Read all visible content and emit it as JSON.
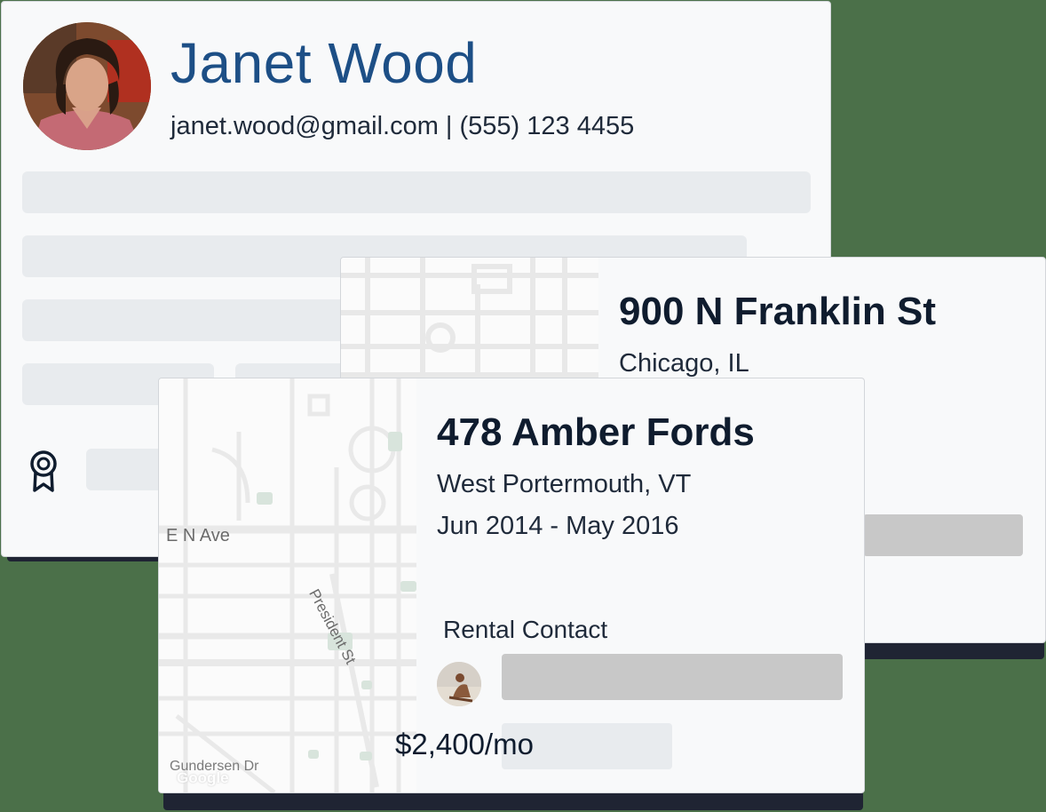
{
  "profile": {
    "name": "Janet Wood",
    "contact_line": "janet.wood@gmail.com | (555) 123 4455"
  },
  "address_back": {
    "street": "900 N Franklin St",
    "city": "Chicago, IL"
  },
  "address_front": {
    "street": "478 Amber Fords",
    "city": "West Portermouth, VT",
    "dates": "Jun 2014 - May 2016",
    "rental_contact_label": "Rental Contact",
    "rent": "$2,400/mo"
  },
  "map_labels": {
    "avenue": "E N Ave",
    "street": "President St",
    "drive": "Gundersen Dr",
    "attribution": "Google"
  },
  "colors": {
    "background": "#4b7049",
    "name": "#1d4f86",
    "heading": "#0f1c2e",
    "card": "#f8f9fa",
    "skeleton": "#e8ebee"
  },
  "icons": [
    "award-ribbon-icon"
  ]
}
